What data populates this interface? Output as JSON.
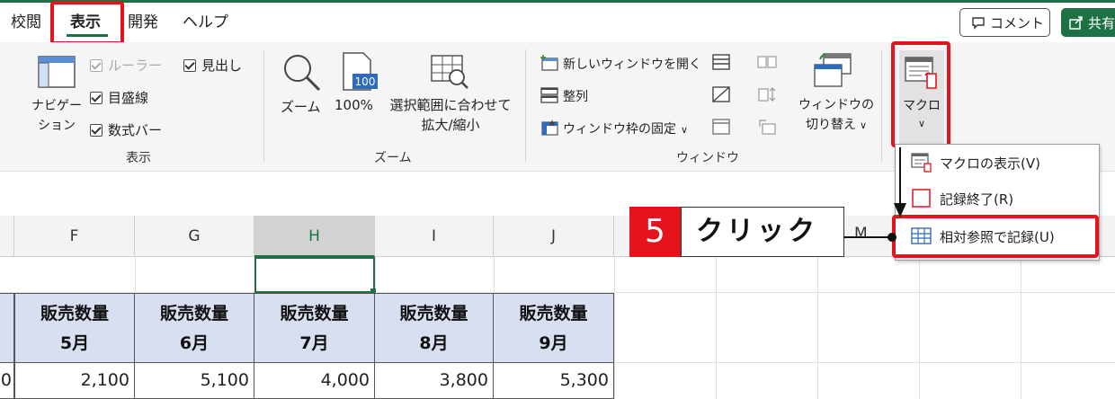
{
  "ribbon_tabs": [
    {
      "label": "校閲"
    },
    {
      "label": "表示",
      "selected": true
    },
    {
      "label": "開発"
    },
    {
      "label": "ヘルプ"
    }
  ],
  "header_buttons": {
    "comment": "コメント",
    "share": "共有"
  },
  "groups": {
    "show": {
      "label": "表示",
      "navigation_line1": "ナビゲー",
      "navigation_line2": "ション",
      "ruler": "ルーラー",
      "headings": "見出し",
      "gridlines": "目盛線",
      "formula_bar": "数式バー"
    },
    "zoom": {
      "label": "ズーム",
      "zoom": "ズーム",
      "zoom100": "100%",
      "zoom100_icon_text": "100",
      "zoom_selection_line1": "選択範囲に合わせて",
      "zoom_selection_line2": "拡大/縮小"
    },
    "window": {
      "label": "ウィンドウ",
      "new_window": "新しいウィンドウを開く",
      "arrange": "整列",
      "freeze": "ウィンドウ枠の固定",
      "switch_line1": "ウィンドウの",
      "switch_line2": "切り替え"
    },
    "macro": {
      "label": "マクロ"
    }
  },
  "macro_menu": [
    {
      "label": "マクロの表示(V)",
      "icon": "view-macros-icon"
    },
    {
      "label": "記録終了(R)",
      "icon": "stop-recording-icon"
    },
    {
      "label": "相対参照で記録(U)",
      "icon": "relative-reference-icon"
    }
  ],
  "callout": {
    "number": "5",
    "text": "クリック"
  },
  "columns": [
    "F",
    "G",
    "H",
    "I",
    "J",
    "M"
  ],
  "table": {
    "headers": [
      {
        "line1": "販売数量",
        "line2": "5月"
      },
      {
        "line1": "販売数量",
        "line2": "6月"
      },
      {
        "line1": "販売数量",
        "line2": "7月"
      },
      {
        "line1": "販売数量",
        "line2": "8月"
      },
      {
        "line1": "販売数量",
        "line2": "9月"
      }
    ],
    "row_values": [
      "0",
      "2,100",
      "5,100",
      "4,000",
      "3,800",
      "5,300"
    ]
  },
  "colors": {
    "accent_green": "#1d7144",
    "highlight_red": "#e5141c",
    "table_header_fill": "#d8dff0"
  }
}
